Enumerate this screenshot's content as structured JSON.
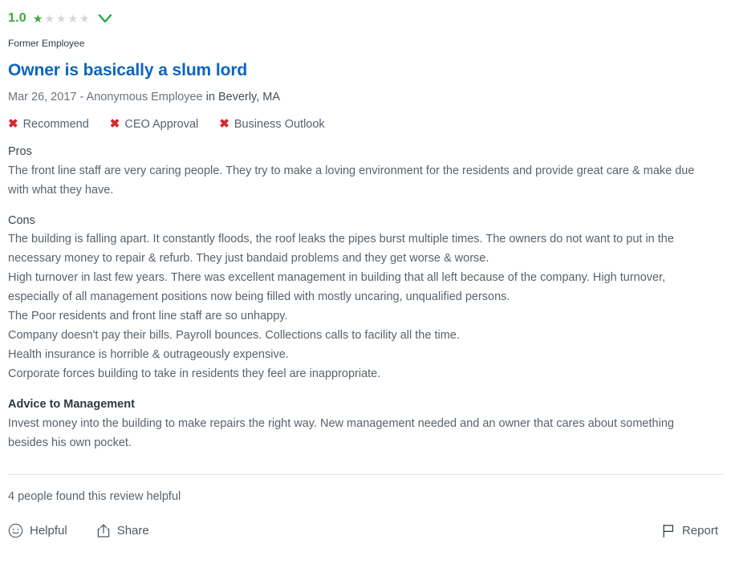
{
  "rating": {
    "value": "1.0",
    "stars_filled": 1,
    "stars_total": 5,
    "star_glyph": "★",
    "color_filled": "#3aaa35",
    "color_empty": "#d3d7da",
    "expand_icon": "chevron-down-icon"
  },
  "employment_status": "Former Employee",
  "title": "Owner is basically a slum lord",
  "meta": {
    "date_author": "Mar 26, 2017 - Anonymous Employee",
    "location": "in Beverly, MA"
  },
  "indicators": [
    {
      "icon": "x-icon",
      "mark": "✖",
      "label": "Recommend",
      "color": "#d8272c"
    },
    {
      "icon": "x-icon",
      "mark": "✖",
      "label": "CEO Approval",
      "color": "#d8272c"
    },
    {
      "icon": "x-icon",
      "mark": "✖",
      "label": "Business Outlook",
      "color": "#d8272c"
    }
  ],
  "sections": {
    "pros": {
      "label": "Pros",
      "text": "The front line staff are very caring people. They try to make a loving environment for the residents and provide great care & make due with what they have."
    },
    "cons": {
      "label": "Cons",
      "paragraphs": [
        "The building is falling apart. It constantly floods, the roof leaks the pipes burst multiple times. The owners do not want to put in the necessary money to repair & refurb. They just bandaid problems and they get worse & worse.",
        "High turnover in last few years. There was excellent management in building that all left because of the company. High turnover, especially of all management positions now being filled with mostly uncaring, unqualified persons.",
        "The Poor residents and front line staff are so unhappy.",
        "Company doesn't pay their bills. Payroll bounces. Collections calls to facility all the time.",
        "Health insurance is horrible & outrageously expensive.",
        "Corporate forces building to take in residents they feel are inappropriate."
      ]
    },
    "advice": {
      "label": "Advice to Management",
      "text": "Invest money into the building to make repairs the right way. New management needed and an owner that cares about something besides his own pocket."
    }
  },
  "footer": {
    "helpful_count_text": "4 people found this review helpful",
    "actions": [
      {
        "icon": "smiley-face-icon",
        "label": "Helpful"
      },
      {
        "icon": "share-upload-icon",
        "label": "Share"
      },
      {
        "icon": "flag-icon",
        "label": "Report"
      }
    ]
  }
}
